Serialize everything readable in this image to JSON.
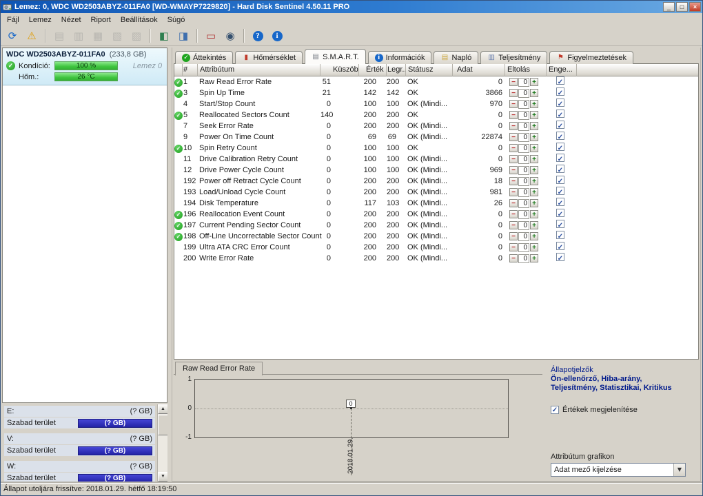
{
  "window": {
    "title": "Lemez: 0, WDC WD2503ABYZ-011FA0 [WD-WMAYP7229820] - Hard Disk Sentinel 4.50.11 PRO",
    "controls": {
      "minimize": "_",
      "maximize": "□",
      "close": "×"
    }
  },
  "menu": {
    "items": [
      "Fájl",
      "Lemez",
      "Nézet",
      "Riport",
      "Beállítások",
      "Súgó"
    ]
  },
  "toolbar": {
    "icons": [
      {
        "name": "refresh-icon",
        "glyph": "⟳",
        "color": "#1767c9",
        "disabled": false
      },
      {
        "name": "problems-report-icon",
        "glyph": "⚠",
        "color": "#e09b00",
        "disabled": false
      },
      {
        "sep": true
      },
      {
        "name": "short-selftest-icon",
        "glyph": "▤",
        "color": "#8f938f",
        "disabled": true
      },
      {
        "name": "extended-selftest-icon",
        "glyph": "▥",
        "color": "#8f938f",
        "disabled": true
      },
      {
        "name": "random-seek-test-icon",
        "glyph": "▦",
        "color": "#8f938f",
        "disabled": true
      },
      {
        "name": "surface-test-icon",
        "glyph": "▧",
        "color": "#8f938f",
        "disabled": true
      },
      {
        "name": "stop-test-icon",
        "glyph": "▨",
        "color": "#8f938f",
        "disabled": true
      },
      {
        "sep": true
      },
      {
        "name": "disk-surface-map-icon",
        "glyph": "◧",
        "color": "#2f7f4f",
        "disabled": false
      },
      {
        "name": "disk-details-icon",
        "glyph": "◨",
        "color": "#3f6fae",
        "disabled": false
      },
      {
        "sep": true
      },
      {
        "name": "performance-monitor-icon",
        "glyph": "▭",
        "color": "#b03434",
        "disabled": false
      },
      {
        "name": "online-status-icon",
        "glyph": "◉",
        "color": "#35506e",
        "disabled": false
      },
      {
        "sep": true
      },
      {
        "name": "help-icon",
        "glyph": "?",
        "badge": true,
        "color": "#1767c9",
        "disabled": false
      },
      {
        "name": "about-icon",
        "glyph": "i",
        "badge": true,
        "color": "#1767c9",
        "disabled": false
      }
    ]
  },
  "sidebar": {
    "disk": {
      "name": "WDC WD2503ABYZ-011FA0",
      "size": "(233,8 GB)",
      "condition_label": "Kondíció:",
      "condition_value": "100 %",
      "temperature_label": "Hőm.:",
      "temperature_value": "26 °C",
      "disk_index_label": "Lemez 0"
    },
    "volumes": [
      {
        "letter": "E:",
        "size": "(? GB)",
        "free_label": "Szabad terület",
        "free_value": "(? GB)"
      },
      {
        "letter": "V:",
        "size": "(? GB)",
        "free_label": "Szabad terület",
        "free_value": "(? GB)"
      },
      {
        "letter": "W:",
        "size": "(? GB)",
        "free_label": "Szabad terület",
        "free_value": "(? GB)"
      }
    ]
  },
  "tabs": [
    {
      "key": "overview",
      "label": "Áttekintés",
      "icon": "overview-check-icon",
      "glyph": "✓",
      "color": "#1fa51f",
      "badge": true,
      "active": false
    },
    {
      "key": "temperature",
      "label": "Hőmérséklet",
      "icon": "thermometer-icon",
      "glyph": "▮",
      "color": "#c03a2a",
      "badge": false,
      "active": false
    },
    {
      "key": "smart",
      "label": "S.M.A.R.T.",
      "icon": "smart-disk-icon",
      "glyph": "▤",
      "color": "#7a7f87",
      "badge": false,
      "active": true
    },
    {
      "key": "information",
      "label": "Információk",
      "icon": "info-icon",
      "glyph": "i",
      "color": "#1767c9",
      "badge": true,
      "active": false
    },
    {
      "key": "log",
      "label": "Napló",
      "icon": "log-icon",
      "glyph": "▤",
      "color": "#caa53a",
      "badge": false,
      "active": false
    },
    {
      "key": "performance",
      "label": "Teljesítmény",
      "icon": "performance-icon",
      "glyph": "▥",
      "color": "#6a7fae",
      "badge": false,
      "active": false
    },
    {
      "key": "alerts",
      "label": "Figyelmeztetések",
      "icon": "alerts-icon",
      "glyph": "⚑",
      "color": "#c03a2a",
      "badge": false,
      "active": false
    }
  ],
  "smart_table": {
    "headers": [
      "#",
      "Attribútum",
      "Küszöb",
      "Érték",
      "Legr...",
      "Státusz",
      "Adat",
      "Eltolás",
      "Enge..."
    ],
    "offset_value": "0",
    "rows": [
      {
        "ok": true,
        "id": "1",
        "name": "Raw Read Error Rate",
        "threshold": "51",
        "value": "200",
        "worst": "200",
        "status": "OK",
        "data": "0"
      },
      {
        "ok": true,
        "id": "3",
        "name": "Spin Up Time",
        "threshold": "21",
        "value": "142",
        "worst": "142",
        "status": "OK",
        "data": "3866"
      },
      {
        "ok": false,
        "id": "4",
        "name": "Start/Stop Count",
        "threshold": "0",
        "value": "100",
        "worst": "100",
        "status": "OK (Mindi...",
        "data": "970"
      },
      {
        "ok": true,
        "id": "5",
        "name": "Reallocated Sectors Count",
        "threshold": "140",
        "value": "200",
        "worst": "200",
        "status": "OK",
        "data": "0"
      },
      {
        "ok": false,
        "id": "7",
        "name": "Seek Error Rate",
        "threshold": "0",
        "value": "200",
        "worst": "200",
        "status": "OK (Mindi...",
        "data": "0"
      },
      {
        "ok": false,
        "id": "9",
        "name": "Power On Time Count",
        "threshold": "0",
        "value": "69",
        "worst": "69",
        "status": "OK (Mindi...",
        "data": "22874"
      },
      {
        "ok": true,
        "id": "10",
        "name": "Spin Retry Count",
        "threshold": "0",
        "value": "100",
        "worst": "100",
        "status": "OK",
        "data": "0"
      },
      {
        "ok": false,
        "id": "11",
        "name": "Drive Calibration Retry Count",
        "threshold": "0",
        "value": "100",
        "worst": "100",
        "status": "OK (Mindi...",
        "data": "0"
      },
      {
        "ok": false,
        "id": "12",
        "name": "Drive Power Cycle Count",
        "threshold": "0",
        "value": "100",
        "worst": "100",
        "status": "OK (Mindi...",
        "data": "969"
      },
      {
        "ok": false,
        "id": "192",
        "name": "Power off Retract Cycle Count",
        "threshold": "0",
        "value": "200",
        "worst": "200",
        "status": "OK (Mindi...",
        "data": "18"
      },
      {
        "ok": false,
        "id": "193",
        "name": "Load/Unload Cycle Count",
        "threshold": "0",
        "value": "200",
        "worst": "200",
        "status": "OK (Mindi...",
        "data": "981"
      },
      {
        "ok": false,
        "id": "194",
        "name": "Disk Temperature",
        "threshold": "0",
        "value": "117",
        "worst": "103",
        "status": "OK (Mindi...",
        "data": "26"
      },
      {
        "ok": true,
        "id": "196",
        "name": "Reallocation Event Count",
        "threshold": "0",
        "value": "200",
        "worst": "200",
        "status": "OK (Mindi...",
        "data": "0"
      },
      {
        "ok": true,
        "id": "197",
        "name": "Current Pending Sector Count",
        "threshold": "0",
        "value": "200",
        "worst": "200",
        "status": "OK (Mindi...",
        "data": "0"
      },
      {
        "ok": true,
        "id": "198",
        "name": "Off-Line Uncorrectable Sector Count",
        "threshold": "0",
        "value": "200",
        "worst": "200",
        "status": "OK (Mindi...",
        "data": "0"
      },
      {
        "ok": false,
        "id": "199",
        "name": "Ultra ATA CRC Error Count",
        "threshold": "0",
        "value": "200",
        "worst": "200",
        "status": "OK (Mindi...",
        "data": "0"
      },
      {
        "ok": false,
        "id": "200",
        "name": "Write Error Rate",
        "threshold": "0",
        "value": "200",
        "worst": "200",
        "status": "OK (Mindi...",
        "data": "0"
      }
    ]
  },
  "chart": {
    "tab_label": "Raw Read Error Rate",
    "type": "line",
    "y_ticks": [
      "1",
      "0",
      "-1"
    ],
    "ylim": [
      -1,
      1
    ],
    "x_label": "2018.01.29.",
    "point_label": "0",
    "series": [
      {
        "x": "2018.01.29.",
        "y": 0
      }
    ]
  },
  "side_panel": {
    "indicators_title": "Állapotjelzők",
    "indicators_line1": "Ön-ellenőrző, Hiba-arány,",
    "indicators_line2": "Teljesítmény, Statisztikai, Kritikus",
    "show_values_label": "Értékek megjelenítése",
    "attribute_graph_label": "Attribútum grafikon",
    "graph_mode_value": "Adat mező kijelzése"
  },
  "statusbar": {
    "text": "Állapot utoljára frissítve: 2018.01.29. hétfő 18:19:50"
  }
}
